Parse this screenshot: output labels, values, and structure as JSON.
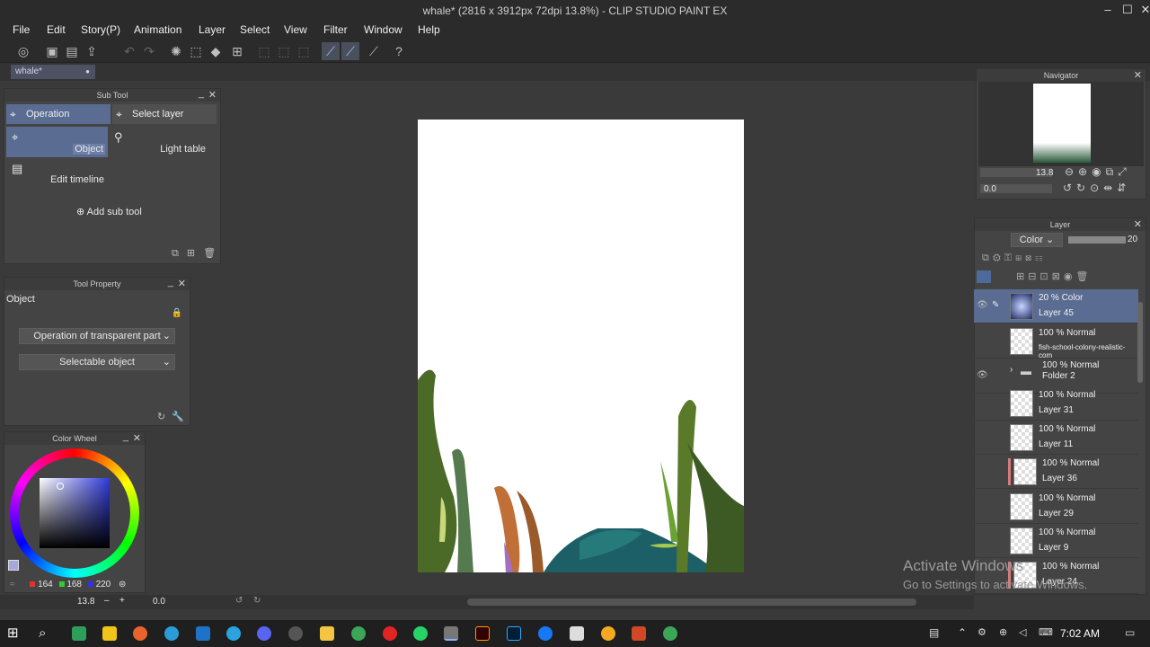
{
  "window": {
    "title": "whale* (2816 x 3912px 72dpi 13.8%) - CLIP STUDIO PAINT EX",
    "minimize_icon": "minimize-icon",
    "maximize_icon": "maximize-icon",
    "close_icon": "close-icon"
  },
  "menubar": {
    "items": [
      "File",
      "Edit",
      "Story(P)",
      "Animation",
      "Layer",
      "Select",
      "View",
      "Filter",
      "Window",
      "Help"
    ]
  },
  "doc_tab": {
    "label": "whale*"
  },
  "sub_tool": {
    "title": "Sub Tool",
    "tab_operation": "Operation",
    "tab_select_layer": "Select layer",
    "tool_object": "Object",
    "tool_light_table": "Light table",
    "tool_edit_timeline": "Edit timeline",
    "add_sub_tool": "Add sub tool"
  },
  "tool_property": {
    "title": "Tool Property",
    "heading": "Object",
    "dropdown_transparent": "Operation of transparent part",
    "dropdown_selectable": "Selectable object"
  },
  "color_wheel": {
    "title": "Color Wheel",
    "r": "164",
    "g": "168",
    "b": "220"
  },
  "status_bar": {
    "zoom": "13.8",
    "angle": "0.0"
  },
  "navigator": {
    "title": "Navigator",
    "zoom": "13.8",
    "rotation": "0.0"
  },
  "layer_panel": {
    "title": "Layer",
    "blend_mode": "Color",
    "opacity": "20",
    "layers": [
      {
        "mode": "20 % Color",
        "name": "Layer 45"
      },
      {
        "mode": "100 % Normal",
        "name": "fish-school-colony-realistic-com"
      },
      {
        "mode": "100 % Normal",
        "name": "Folder 2"
      },
      {
        "mode": "100 % Normal",
        "name": "Layer 31"
      },
      {
        "mode": "100 % Normal",
        "name": "Layer 11"
      },
      {
        "mode": "100 % Normal",
        "name": "Layer 36"
      },
      {
        "mode": "100 % Normal",
        "name": "Layer 29"
      },
      {
        "mode": "100 % Normal",
        "name": "Layer 9"
      },
      {
        "mode": "100 % Normal",
        "name": "Layer 24"
      }
    ]
  },
  "watermark": {
    "line1": "Activate Windows",
    "line2": "Go to Settings to activate Windows."
  },
  "taskbar": {
    "time": "7:02 AM"
  }
}
